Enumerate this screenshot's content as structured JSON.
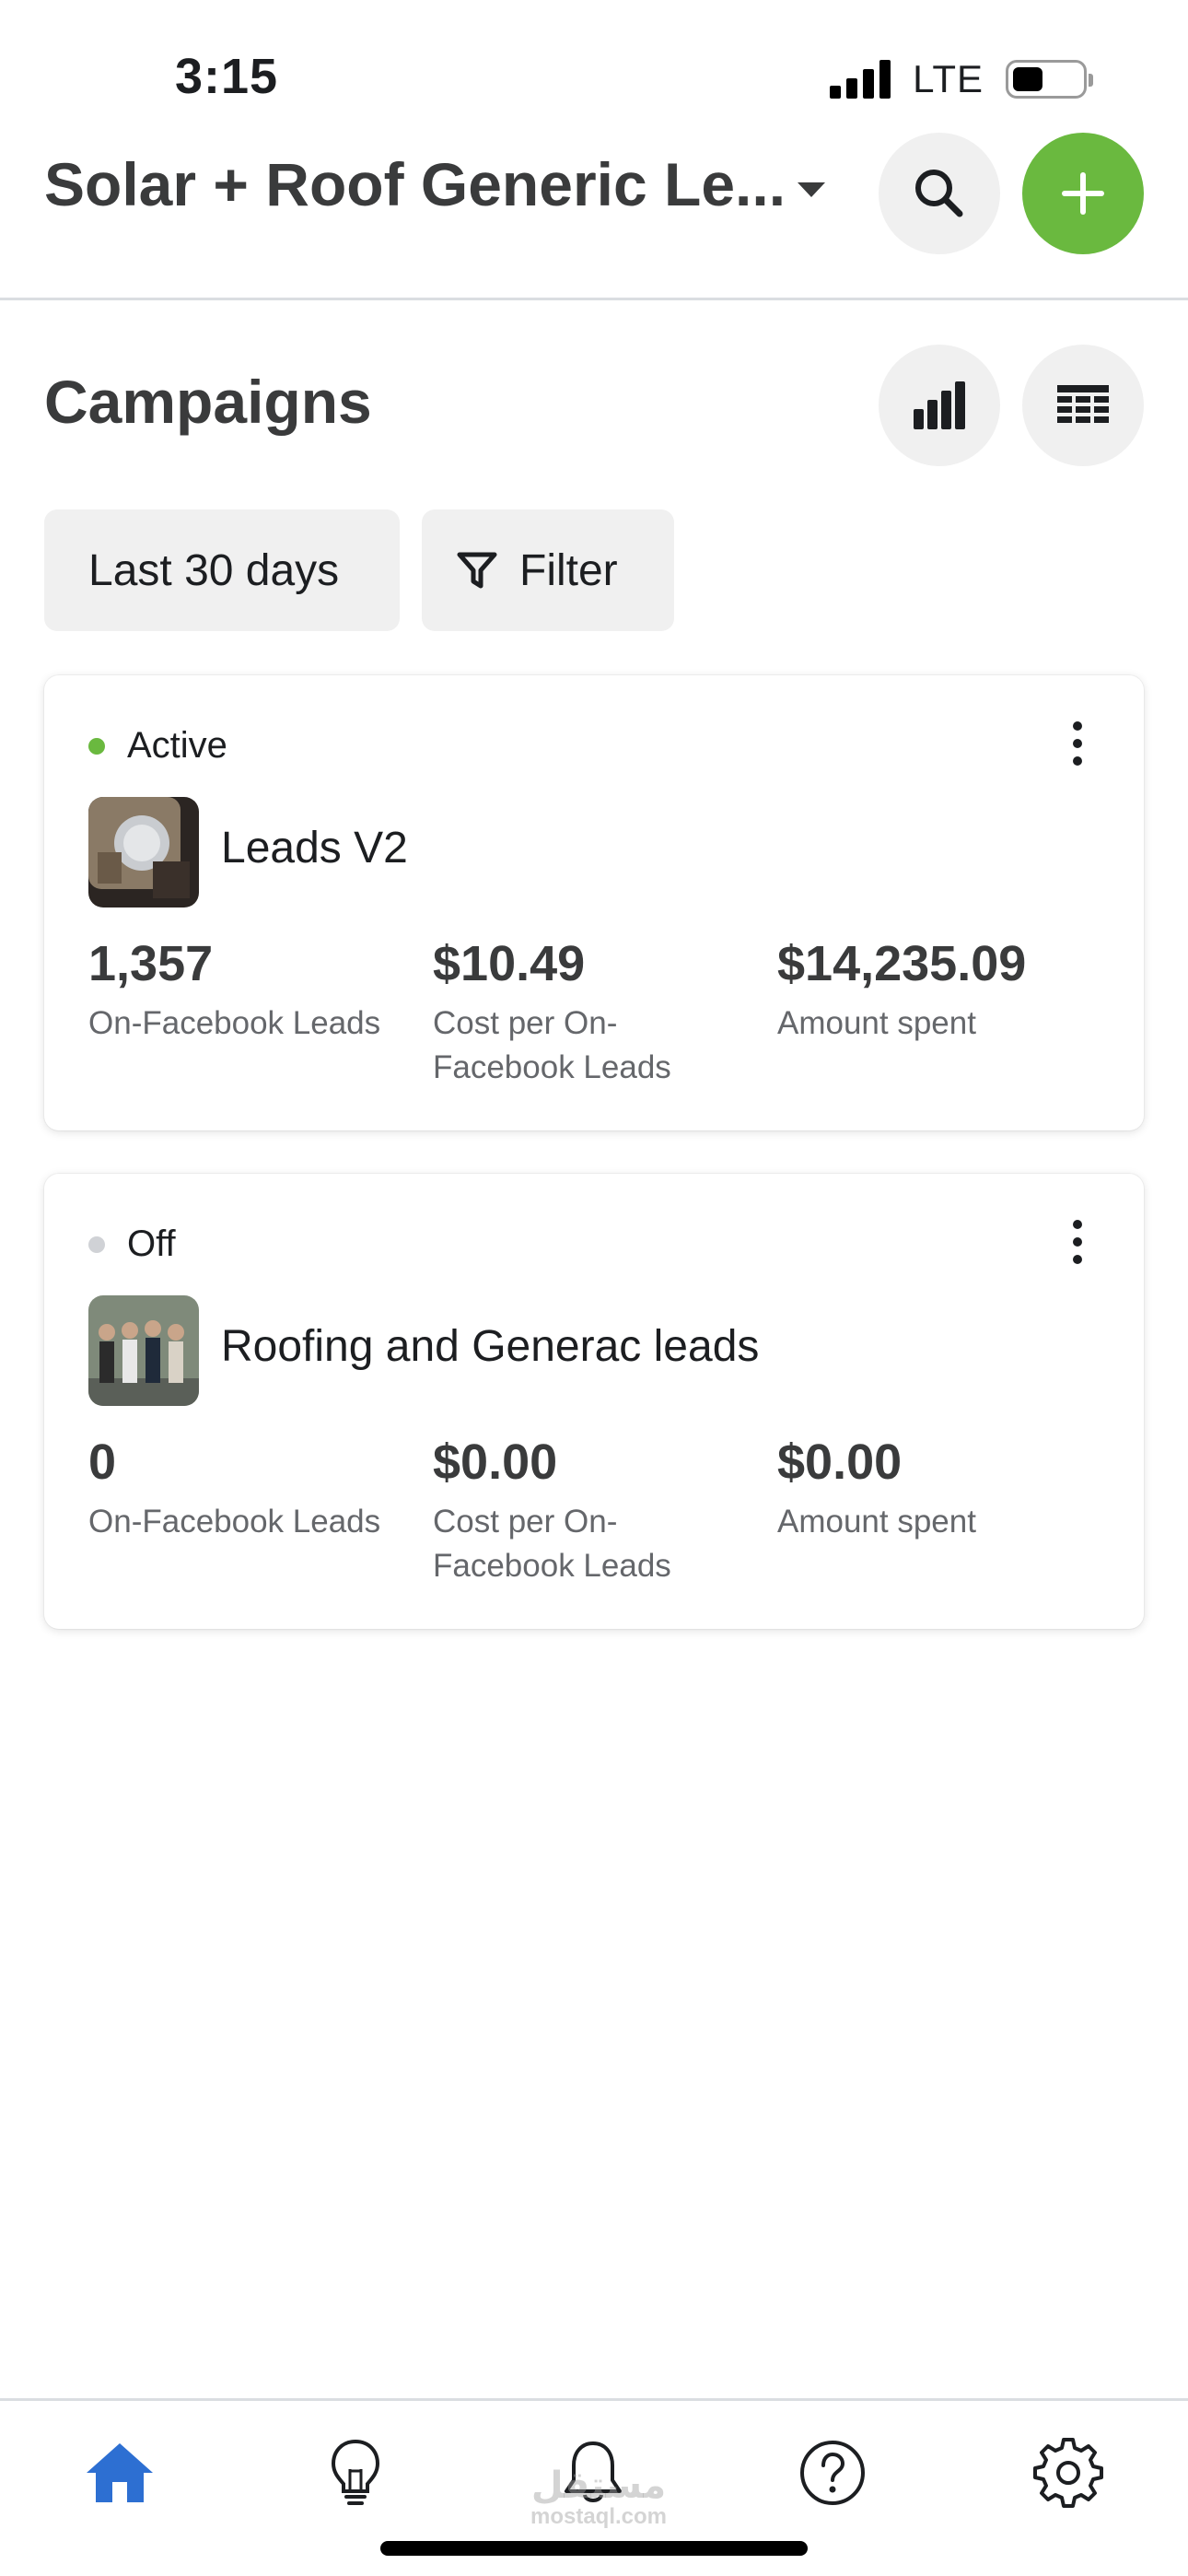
{
  "status_bar": {
    "time": "3:15",
    "network": "LTE",
    "battery_level": 0.45
  },
  "header": {
    "account_title": "Solar + Roof Generic Le...",
    "search_icon": "search-icon",
    "add_icon": "plus-icon",
    "accent_color": "#6ab93f"
  },
  "campaigns": {
    "title": "Campaigns",
    "chart_icon": "bar-chart-icon",
    "table_icon": "table-icon",
    "date_range": "Last 30 days",
    "filter_label": "Filter",
    "items": [
      {
        "status": "Active",
        "status_color": "#6ab93f",
        "name": "Leads V2",
        "metrics": [
          {
            "value": "1,357",
            "label": "On-Facebook Leads"
          },
          {
            "value": "$10.49",
            "label": "Cost per On-Facebook Leads"
          },
          {
            "value": "$14,235.09",
            "label": "Amount spent"
          }
        ]
      },
      {
        "status": "Off",
        "status_color": "#d0d2d6",
        "name": "Roofing and Generac leads",
        "metrics": [
          {
            "value": "0",
            "label": "On-Facebook Leads"
          },
          {
            "value": "$0.00",
            "label": "Cost per On-Facebook Leads"
          },
          {
            "value": "$0.00",
            "label": "Amount spent"
          }
        ]
      }
    ]
  },
  "bottom_nav": {
    "items": [
      "home-icon",
      "lightbulb-icon",
      "bell-icon",
      "help-icon",
      "gear-icon"
    ],
    "active_color": "#2d6fd2",
    "watermark": "مستقل",
    "watermark_sub": "mostaql.com"
  }
}
